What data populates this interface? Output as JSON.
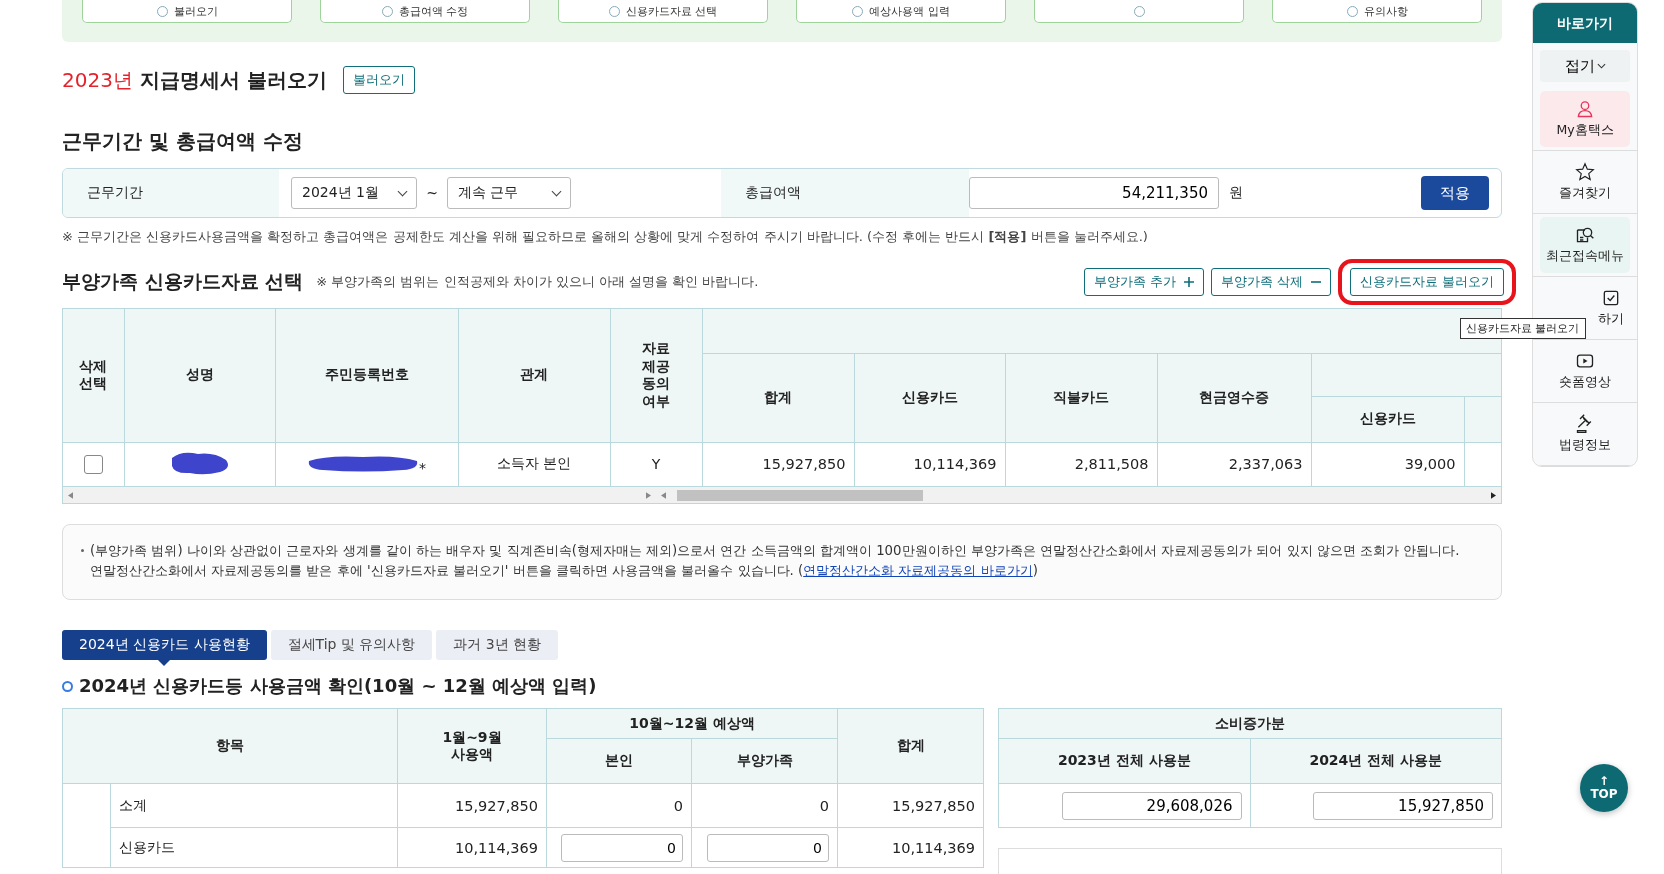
{
  "steps": [
    {
      "kind": "labeled",
      "label": "불러오기"
    },
    {
      "kind": "labeled",
      "label": "총급여액 수정"
    },
    {
      "kind": "labeled",
      "label": "신용카드자료 선택"
    },
    {
      "kind": "labeled",
      "label": "예상사용액 입력"
    },
    {
      "kind": "icon_only"
    },
    {
      "kind": "labeled",
      "label": "유의사항"
    }
  ],
  "statement": {
    "year": "2023년",
    "title": "지급명세서 불러오기",
    "button": "불러오기"
  },
  "period": {
    "heading": "근무기간 및 총급여액 수정",
    "period_label": "근무기간",
    "start": "2024년 1월",
    "separator": "~",
    "end": "계속 근무",
    "total_label": "총급여액",
    "total": "54,211,350",
    "unit": "원",
    "apply": "적용"
  },
  "note": "※ 근무기간은 신용카드사용금액을 확정하고 총급여액은 공제한도 계산을 위해 필요하므로 올해의 상황에 맞게 수정하여 주시기 바랍니다. (수정 후에는 반드시 **[적용]** 버튼을 눌러주세요.)",
  "dependents": {
    "heading": "부양가족 신용카드자료 선택",
    "hint": "※ 부양가족의 범위는 인적공제와 차이가 있으니 아래 설명을 확인 바랍니다.",
    "buttons": [
      {
        "label": "부양가족 추가",
        "kind": "add",
        "highlighted": false
      },
      {
        "label": "부양가족 삭제",
        "kind": "remove",
        "highlighted": false
      },
      {
        "label": "신용카드자료 불러오기",
        "kind": "plain",
        "highlighted": true
      }
    ],
    "tooltip": "신용카드자료 불러오기",
    "fixed_columns": [
      "삭제 선택",
      "성명",
      "주민등록번호",
      "관계",
      "자료 제공 동의 여부"
    ],
    "amount_columns": [
      "합계",
      "신용카드",
      "직불카드",
      "현금영수증"
    ],
    "sub_columns": [
      "신용카드"
    ],
    "rows": [
      {
        "checked": false,
        "id_suffix": "*",
        "relation": "소득자 본인",
        "consent": "Y",
        "values": [
          "15,927,850",
          "10,114,369",
          "2,811,508",
          "2,337,063",
          "39,000"
        ]
      }
    ]
  },
  "info": {
    "text": "(부양가족 범위) 나이와 상관없이 근로자와 생계를 같이 하는 배우자 및 직계존비속(형제자매는 제외)으로서 연간 소득금액의 합계액이 100만원이하인 부양가족은 연말정산간소화에서 자료제공동의가 되어 있지 않으면 조회가 안됩니다. 연말정산간소화에서 자료제공동의를 받은 후에 '신용카드자료 불러오기' 버튼을 클릭하면 사용금액을 불러올수 있습니다. (",
    "link": "연말정산간소화 자료제공동의 바로가기",
    "after": ")"
  },
  "tabs": [
    {
      "label": "2024년 신용카드 사용현황",
      "selected": true
    },
    {
      "label": "절세Tip 및 유의사항",
      "selected": false
    },
    {
      "label": "과거 3년 현황",
      "selected": false
    }
  ],
  "usage": {
    "heading": "2024년 신용카드등 사용금액 확인(10월 ~ 12월 예상액 입력)",
    "item": "항목",
    "jan_sep": "1월~9월 사용액",
    "forecast": "10월~12월 예상액",
    "self": "본인",
    "family": "부양가족",
    "total": "합계",
    "rows": [
      {
        "kind": "sum",
        "label": "소계",
        "jan_sep": "15,927,850",
        "self": "0",
        "family": "0",
        "total": "15,927,850"
      },
      {
        "kind": "input",
        "label": "신용카드",
        "jan_sep": "10,114,369",
        "self": "0",
        "family": "0",
        "total": "10,114,369"
      }
    ]
  },
  "increase": {
    "title": "소비증가분",
    "columns": [
      "2023년 전체 사용분",
      "2024년 전체 사용분"
    ],
    "values": [
      "29,608,026",
      "15,927,850"
    ]
  },
  "sidebar": {
    "title": "바로가기",
    "collapse": "접기",
    "items": [
      {
        "label": "My홈택스",
        "color": "#fce9ec"
      },
      {
        "label": "즐겨찾기"
      },
      {
        "label": "최근접속메뉴",
        "color": "#e8f5f2"
      },
      {
        "label": "하기"
      },
      {
        "label": "숏폼영상"
      },
      {
        "label": "법령정보"
      }
    ]
  },
  "top_button": {
    "arrow": "↑",
    "label": "TOP"
  }
}
